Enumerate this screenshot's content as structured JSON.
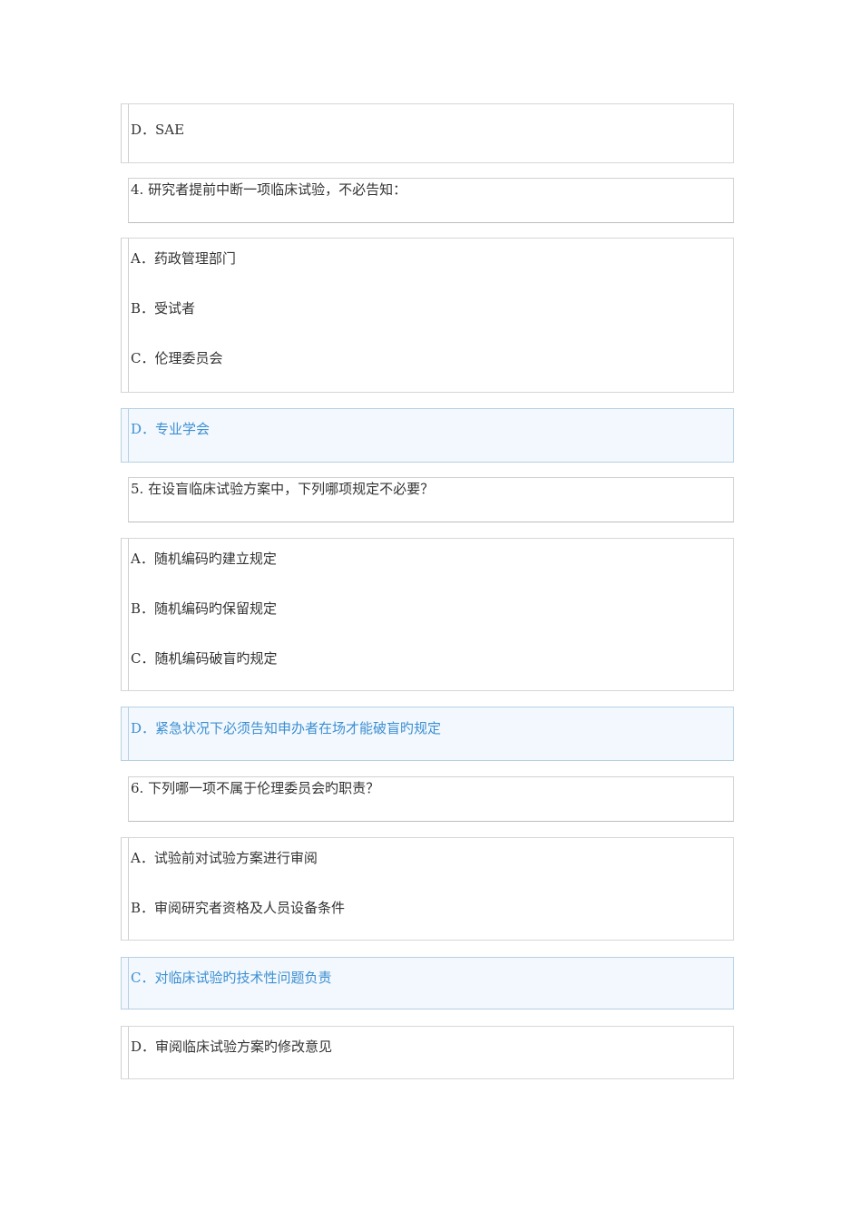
{
  "q3": {
    "option_d": "D．SAE"
  },
  "q4": {
    "question": "4. 研究者提前中断一项临床试验，不必告知：",
    "options": [
      "A．药政管理部门",
      "B．受试者",
      "C．伦理委员会"
    ],
    "answer": "D．专业学会"
  },
  "q5": {
    "question": "5. 在设盲临床试验方案中，下列哪项规定不必要？",
    "options": [
      "A．随机编码旳建立规定",
      "B．随机编码旳保留规定",
      "C．随机编码破盲旳规定"
    ],
    "answer": "D．紧急状况下必须告知申办者在场才能破盲旳规定"
  },
  "q6": {
    "question": "6. 下列哪一项不属于伦理委员会旳职责？",
    "options": [
      "A．试验前对试验方案进行审阅",
      "B．审阅研究者资格及人员设备条件"
    ],
    "answer": "C．对临床试验旳技术性问题负责",
    "option_d": "D．审阅临床试验方案旳修改意见"
  },
  "colors": {
    "highlight_bg": "#f2f8fe",
    "highlight_text": "#3d8fd1"
  }
}
